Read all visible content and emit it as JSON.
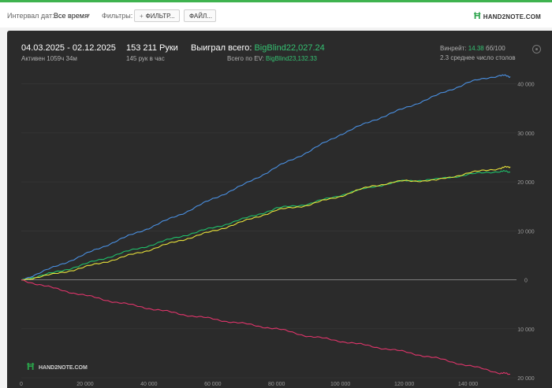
{
  "toolbar": {
    "date_interval_label": "Интервал дат:",
    "date_interval_value": "Все время",
    "filters_label": "Фильтры:",
    "filter_button": "ФИЛЬТР...",
    "files_button": "ФАЙЛ...",
    "logo_text": "HAND2NOTE.COM"
  },
  "stats": {
    "date_range": "04.03.2025 - 02.12.2025",
    "active_time": "Активен 1059ч 34м",
    "hands": "153 211 Руки",
    "hands_per_hour": "145 рук в час",
    "won_label": "Выиграл всего:",
    "won_value": "BigBlind22,027.24",
    "ev_label": "Всего по EV:",
    "ev_value": "BigBlind23,132.33",
    "winrate_label": "Винрейт:",
    "winrate_value": "14.38",
    "winrate_unit": "бб/100",
    "tables_avg": "2.3 среднее число столов"
  },
  "watermark": "HAND2NOTE.COM",
  "colors": {
    "total": "#4a90e2",
    "won": "#1fbf6a",
    "ev": "#e8e23a",
    "nonshowdown": "#e0356b",
    "accent": "#35c172"
  },
  "chart_data": {
    "type": "line",
    "x_ticks": [
      "0",
      "20 000",
      "40 000",
      "60 000",
      "80 000",
      "100 000",
      "120 000",
      "140 000"
    ],
    "y_ticks": [
      "40 000",
      "30 000",
      "20 000",
      "10 000",
      "0",
      "10 000",
      "20 000"
    ],
    "xlim": [
      0,
      153211
    ],
    "ylim": [
      -20000,
      43000
    ],
    "series": [
      {
        "color_key": "total",
        "x": [
          0,
          10000,
          20000,
          30000,
          40000,
          50000,
          60000,
          70000,
          80000,
          90000,
          100000,
          110000,
          120000,
          130000,
          140000,
          150000,
          153211
        ],
        "y": [
          0,
          2500,
          5200,
          8000,
          10600,
          13400,
          16500,
          19500,
          23000,
          26200,
          29700,
          32500,
          35000,
          37600,
          40300,
          41800,
          41500
        ]
      },
      {
        "color_key": "won",
        "x": [
          0,
          10000,
          20000,
          30000,
          40000,
          50000,
          60000,
          70000,
          80000,
          90000,
          100000,
          110000,
          120000,
          130000,
          140000,
          150000,
          153211
        ],
        "y": [
          0,
          1400,
          3200,
          5200,
          7000,
          8900,
          10600,
          12500,
          14600,
          15500,
          17300,
          19000,
          20200,
          20500,
          21500,
          22200,
          22000
        ]
      },
      {
        "color_key": "ev",
        "x": [
          0,
          10000,
          20000,
          30000,
          40000,
          50000,
          60000,
          70000,
          80000,
          90000,
          100000,
          110000,
          120000,
          130000,
          140000,
          150000,
          153211
        ],
        "y": [
          0,
          1100,
          2600,
          4300,
          6100,
          8100,
          9900,
          12000,
          14200,
          15300,
          17100,
          19200,
          20200,
          20300,
          21800,
          22800,
          23100
        ]
      },
      {
        "color_key": "nonshowdown",
        "x": [
          0,
          10000,
          20000,
          30000,
          40000,
          50000,
          60000,
          70000,
          80000,
          90000,
          100000,
          110000,
          120000,
          130000,
          140000,
          150000,
          153211
        ],
        "y": [
          0,
          -1700,
          -3200,
          -4600,
          -5800,
          -7000,
          -8000,
          -9000,
          -10000,
          -11500,
          -12500,
          -13600,
          -14700,
          -16000,
          -17500,
          -19000,
          -19300
        ]
      }
    ]
  }
}
